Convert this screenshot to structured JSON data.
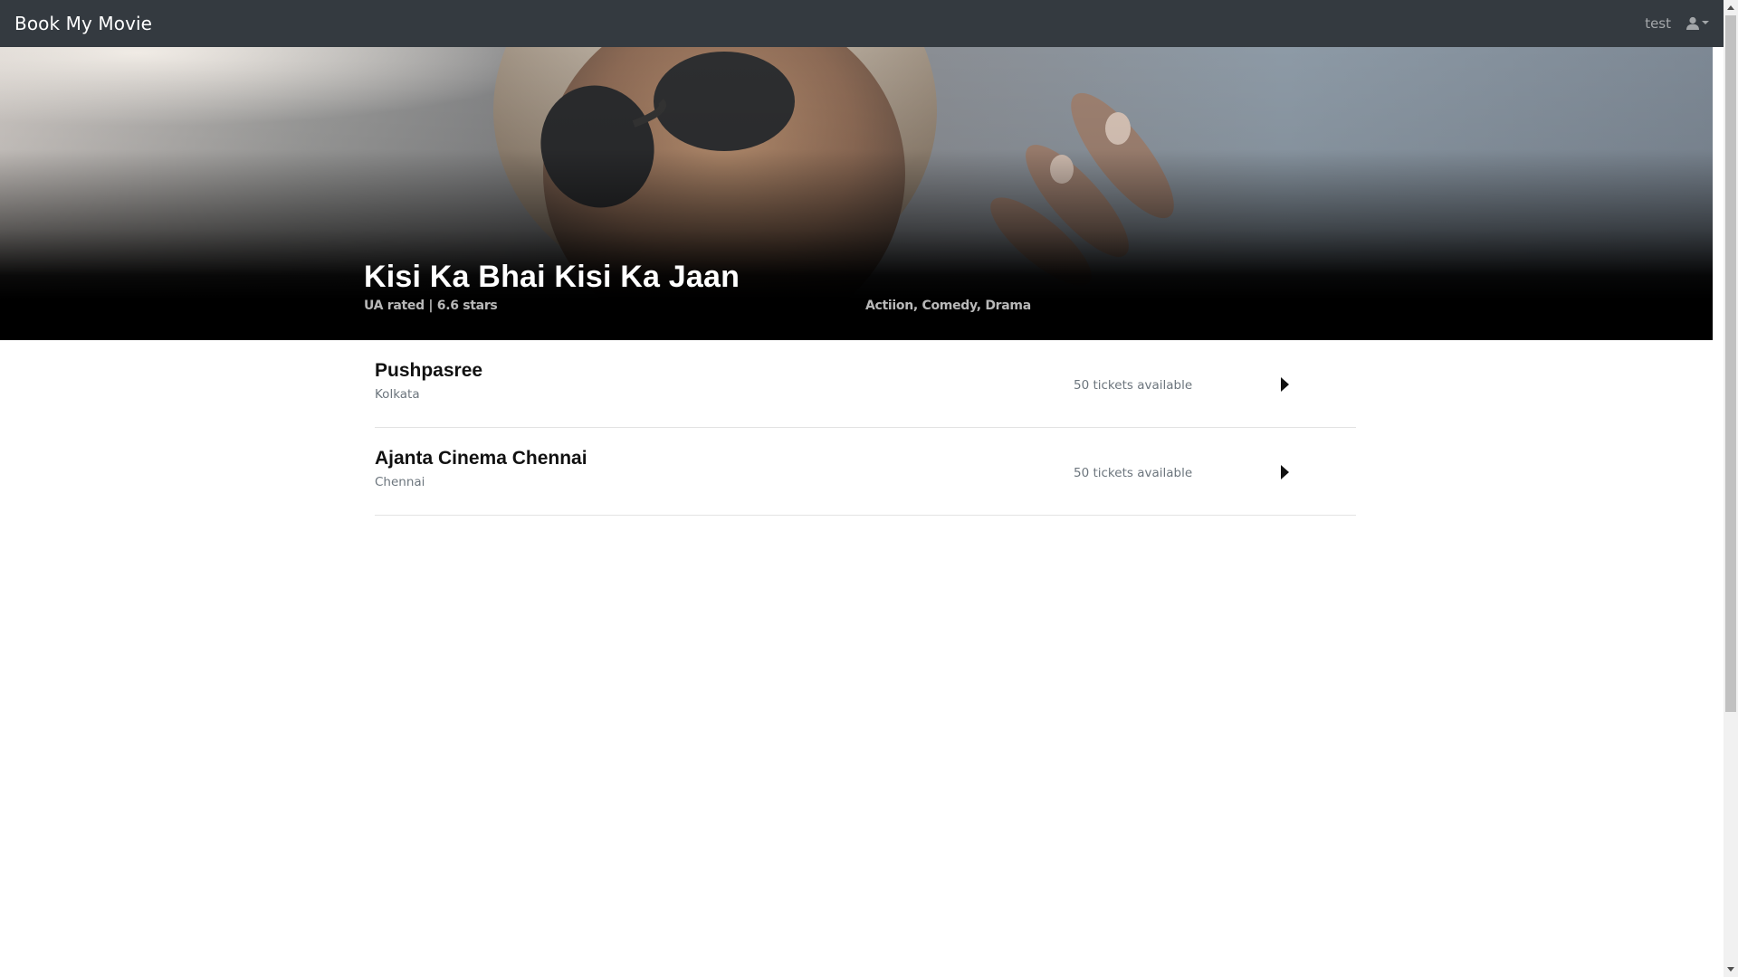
{
  "navbar": {
    "brand": "Book My Movie",
    "username": "test",
    "user_menu_icon": "user-icon"
  },
  "movie": {
    "title": "Kisi Ka Bhai Kisi Ka Jaan",
    "meta": "UA rated | 6.6 stars",
    "genres": "Actiion, Comedy, Drama"
  },
  "theatres": [
    {
      "name": "Pushpasree",
      "city": "Kolkata",
      "tickets": "50 tickets available"
    },
    {
      "name": "Ajanta Cinema Chennai",
      "city": "Chennai",
      "tickets": "50 tickets available"
    }
  ],
  "colors": {
    "navbar_bg": "#343a40",
    "muted_text": "#6c757d"
  }
}
